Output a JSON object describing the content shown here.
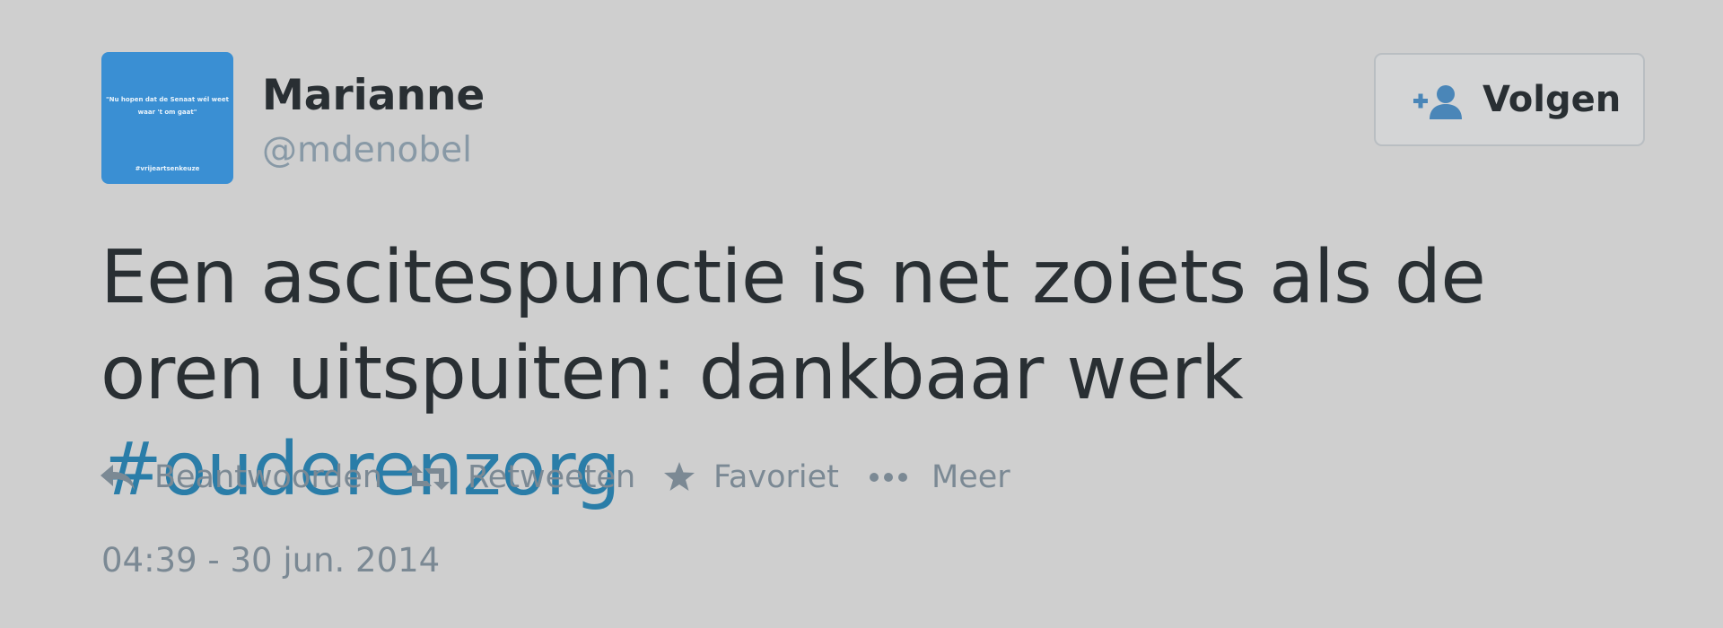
{
  "user": {
    "name": "Marianne",
    "handle": "@mdenobel",
    "avatar": {
      "quote": "\"Nu hopen dat de Senaat wél weet waar 't om gaat\"",
      "tag": "#vrijeartsenkeuze",
      "color": "#3a8fd3"
    }
  },
  "follow": {
    "label": "Volgen",
    "icon": "follow-user-icon"
  },
  "tweet": {
    "text": "Een ascitespunctie is net zoiets als de oren uitspuiten: dankbaar werk ",
    "hashtag": "#ouderenzorg",
    "hashtag_color": "#2a7da8"
  },
  "actions": {
    "reply": {
      "label": "Beantwoorden",
      "icon": "reply-icon"
    },
    "retweet": {
      "label": "Retweeten",
      "icon": "retweet-icon"
    },
    "favorite": {
      "label": "Favoriet",
      "icon": "star-icon"
    },
    "more": {
      "label": "Meer",
      "icon": "more-dots-icon"
    }
  },
  "timestamp": "04:39 - 30 jun. 2014"
}
